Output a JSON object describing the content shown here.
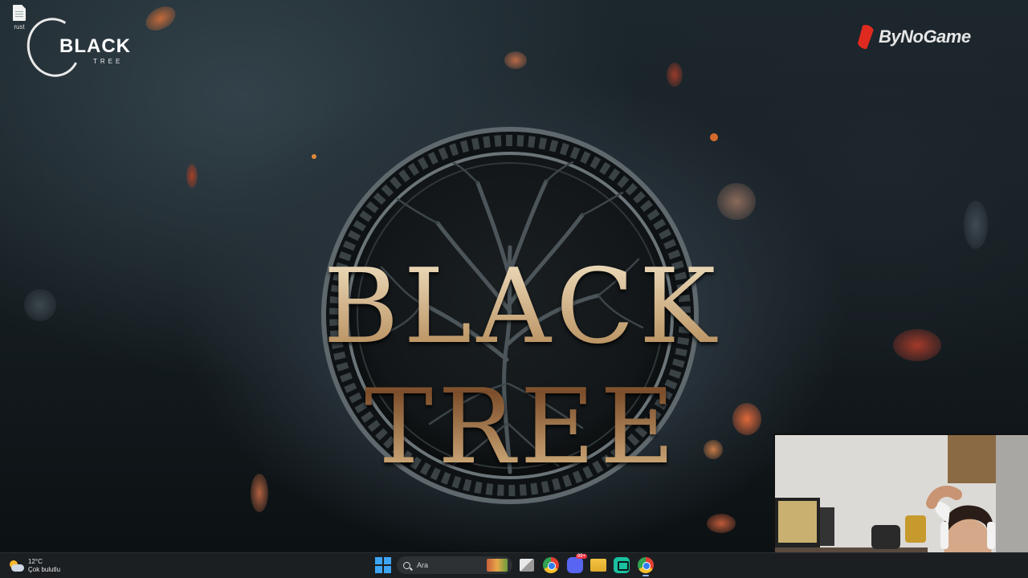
{
  "desktop": {
    "icon_label": "rust"
  },
  "logo": {
    "word1": "BLACK",
    "word2": "TREE"
  },
  "brand": {
    "name": "ByNoGame"
  },
  "wallpaper": {
    "title": "BLACK TREE"
  },
  "taskbar": {
    "weather": {
      "temp": "12°C",
      "condition": "Çok bulutlu",
      "icon": "partly-cloudy-icon"
    },
    "search": {
      "placeholder": "Ara"
    },
    "apps": [
      {
        "name": "task-view",
        "icon": "task-view-icon"
      },
      {
        "name": "chrome",
        "icon": "chrome-icon"
      },
      {
        "name": "discord",
        "icon": "discord-icon",
        "badge": "99+"
      },
      {
        "name": "file-explorer",
        "icon": "folder-icon"
      },
      {
        "name": "twitch",
        "icon": "twitch-icon"
      },
      {
        "name": "chrome-profile",
        "icon": "chrome-icon"
      }
    ]
  },
  "colors": {
    "accent_red": "#e12a1f",
    "title_gold": "#c9a77a",
    "taskbar_bg": "#1c1f22",
    "start_blue": "#3da5f4"
  }
}
